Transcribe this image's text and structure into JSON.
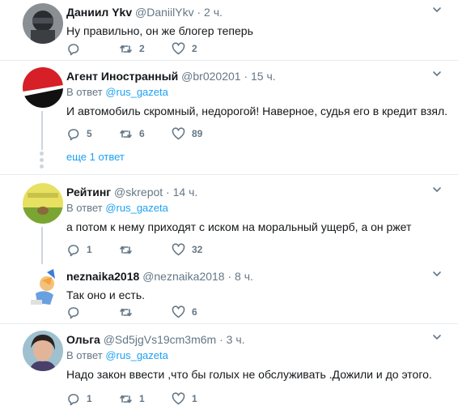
{
  "tweets": [
    {
      "name": "Даниил Ykv",
      "handle": "@DaniilYkv",
      "time": "2 ч.",
      "text": "Ну правильно, он же блогер теперь",
      "reply": "",
      "retweets": "2",
      "likes": "2",
      "reply_to_label": "",
      "reply_to_mention": ""
    },
    {
      "name": "Агент Иностранный",
      "handle": "@br020201",
      "time": "15 ч.",
      "reply_to_label": "В ответ",
      "reply_to_mention": "@rus_gazeta",
      "text": "И автомобиль скромный, недорогой! Наверное, судья его в кредит взял.",
      "reply": "5",
      "retweets": "6",
      "likes": "89"
    },
    {
      "name": "Рейтинг",
      "handle": "@skrepot",
      "time": "14 ч.",
      "reply_to_label": "В ответ",
      "reply_to_mention": "@rus_gazeta",
      "text": "а потом к нему приходят с иском на моральный ущерб, а он ржет",
      "reply": "1",
      "retweets": "",
      "likes": "32"
    },
    {
      "name": "neznaika2018",
      "handle": "@neznaika2018",
      "time": "8 ч.",
      "text": "Так оно и есть.",
      "reply": "",
      "retweets": "",
      "likes": "6",
      "reply_to_label": "",
      "reply_to_mention": ""
    },
    {
      "name": "Ольга",
      "handle": "@Sd5jgVs19cm3m6m",
      "time": "3 ч.",
      "reply_to_label": "В ответ",
      "reply_to_mention": "@rus_gazeta",
      "text": "Надо закон ввести ,что бы голых не обслуживать .Дожили и до этого.",
      "reply": "1",
      "retweets": "1",
      "likes": "1"
    }
  ],
  "more_replies": "еще 1 ответ",
  "separator": "·",
  "colors": {
    "accent": "#1da1f2",
    "muted": "#657786",
    "border": "#e6ecf0",
    "thread": "#ccd6dd"
  },
  "icons": [
    "reply-icon",
    "retweet-icon",
    "like-icon",
    "chevron-down-icon"
  ]
}
